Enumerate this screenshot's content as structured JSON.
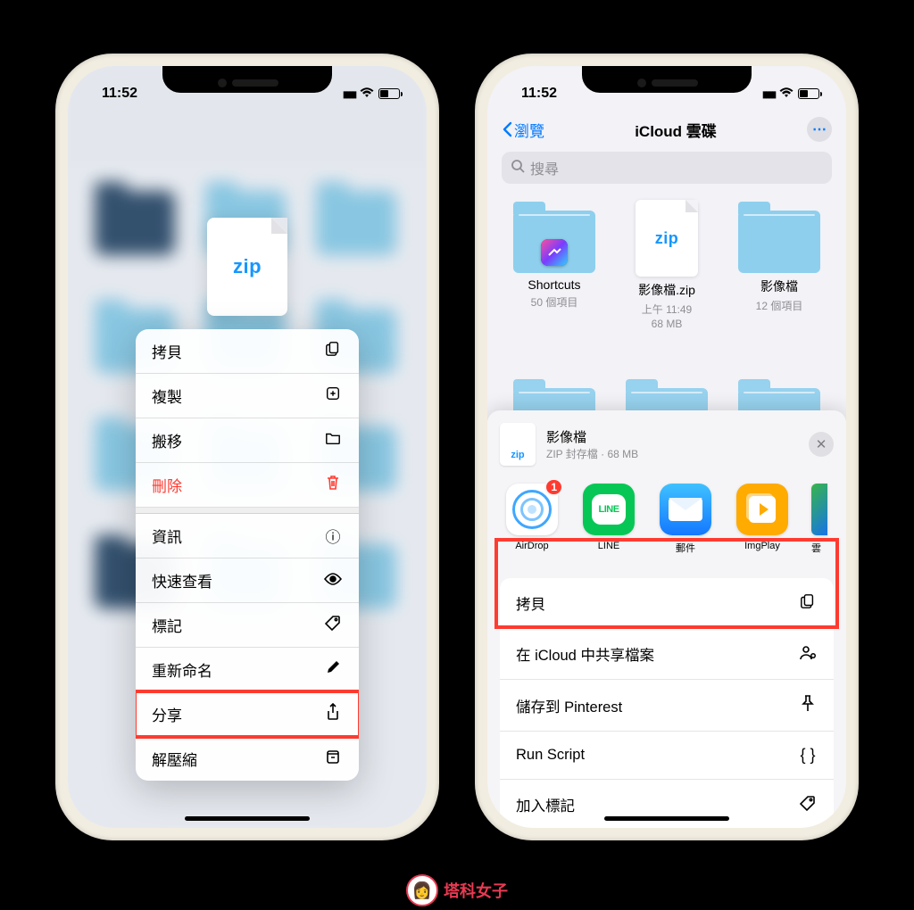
{
  "status": {
    "time": "11:52"
  },
  "left_phone": {
    "zip_badge": "zip",
    "menu": {
      "copy": "拷貝",
      "duplicate": "複製",
      "move": "搬移",
      "delete": "刪除",
      "info": "資訊",
      "quicklook": "快速查看",
      "tags": "標記",
      "rename": "重新命名",
      "share": "分享",
      "uncompress": "解壓縮"
    }
  },
  "right_phone": {
    "nav": {
      "back": "瀏覽",
      "title": "iCloud 雲碟"
    },
    "search_placeholder": "搜尋",
    "files": [
      {
        "name": "Shortcuts",
        "meta": "50 個項目"
      },
      {
        "name": "影像檔.zip",
        "meta": "上午 11:49",
        "meta2": "68 MB"
      },
      {
        "name": "影像檔",
        "meta": "12 個項目"
      }
    ],
    "share": {
      "title": "影像檔",
      "subtitle": "ZIP 封存檔 · 68 MB",
      "apps": [
        {
          "label": "AirDrop",
          "badge": "1"
        },
        {
          "label": "LINE"
        },
        {
          "label": "郵件"
        },
        {
          "label": "ImgPlay"
        },
        {
          "label": "雲"
        }
      ],
      "actions": {
        "copy": "拷貝",
        "icloud_share": "在 iCloud 中共享檔案",
        "pinterest": "儲存到 Pinterest",
        "run_script": "Run Script",
        "add_tags": "加入標記"
      }
    }
  },
  "watermark": "塔科女子"
}
